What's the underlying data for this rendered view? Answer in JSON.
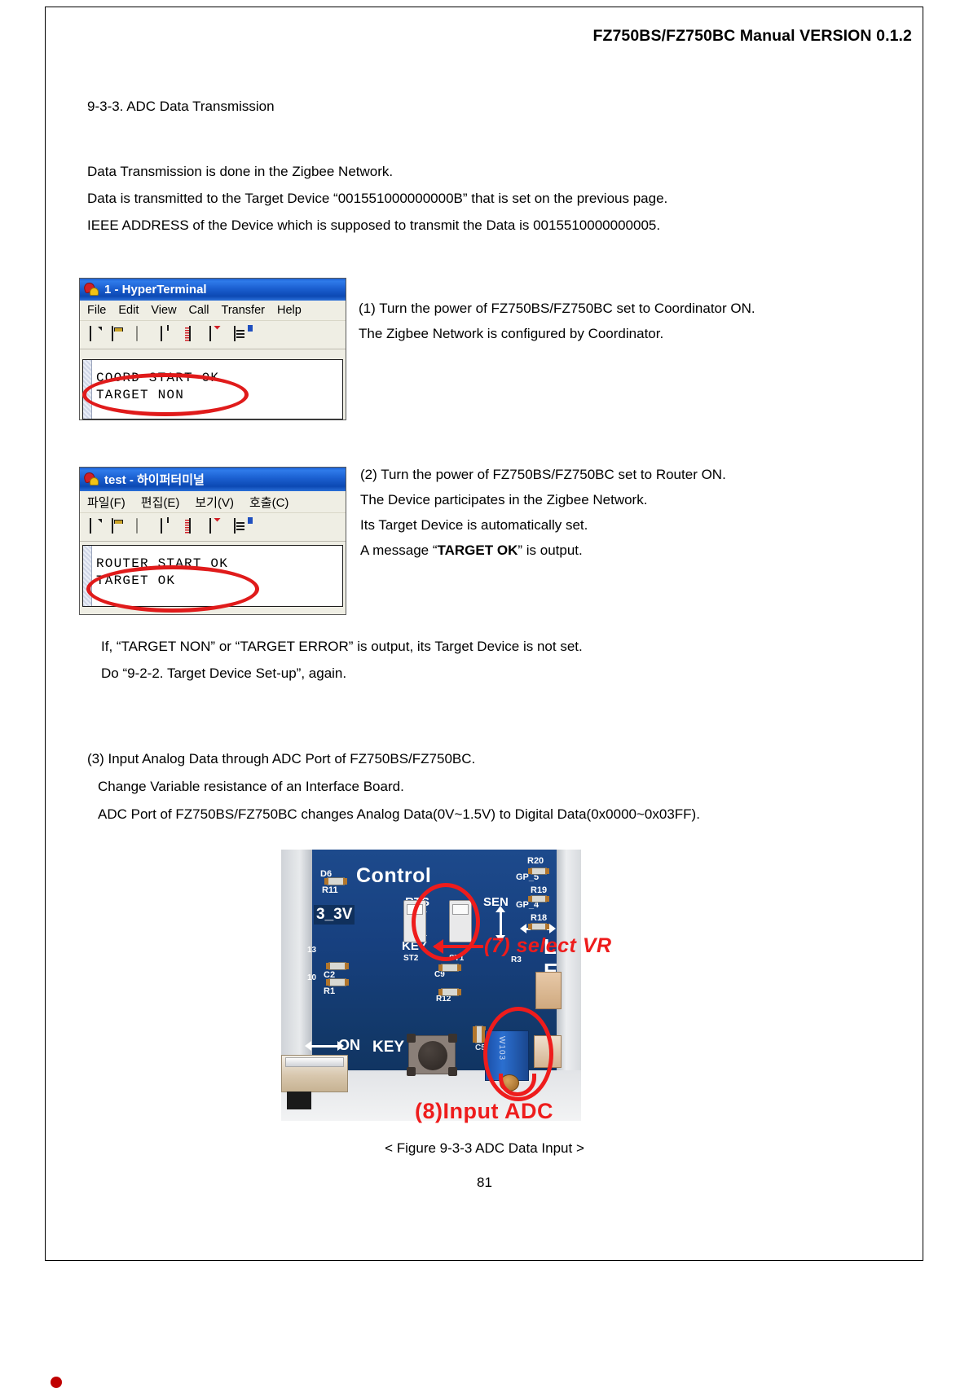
{
  "document": {
    "header_title": "FZ750BS/FZ750BC Manual VERSION 0.1.2",
    "section_heading": "9-3-3. ADC Data Transmission",
    "intro_lines": [
      "Data Transmission is done in the Zigbee Network.",
      "Data is transmitted to the Target Device “001551000000000B” that is set on the previous page.",
      "IEEE ADDRESS of the Device which is supposed to transmit the Data is 0015510000000005."
    ],
    "note_lines": [
      "If, “TARGET NON” or “TARGET ERROR” is output, its Target Device is not set.",
      "Do “9-2-2. Target Device Set-up”, again."
    ],
    "step3_lines": [
      "(3) Input Analog Data through ADC Port of FZ750BS/FZ750BC.",
      "Change Variable resistance of an Interface Board.",
      "ADC Port of FZ750BS/FZ750BC changes Analog Data(0V~1.5V) to Digital Data(0x0000~0x03FF)."
    ],
    "figure_caption": "< Figure 9-3-3 ADC Data Input >",
    "page_number": "81"
  },
  "terminal_one": {
    "title": "1 - HyperTerminal",
    "menu": [
      "File",
      "Edit",
      "View",
      "Call",
      "Transfer",
      "Help"
    ],
    "output": "COORD START OK\nTARGET NON",
    "icon": "hyperterminal-phone-icon"
  },
  "terminal_two": {
    "title": "test - 하이퍼터미널",
    "menu": [
      "파일(F)",
      "편집(E)",
      "보기(V)",
      "호출(C)"
    ],
    "output": "ROUTER START OK\nTARGET OK",
    "icon": "hyperterminal-phone-icon"
  },
  "callout_one": {
    "lines": [
      "(1) Turn the power of FZ750BS/FZ750BC set to Coordinator ON.",
      "The Zigbee Network is configured by Coordinator."
    ]
  },
  "callout_two": {
    "line1": "(2) Turn the power of FZ750BS/FZ750BC set to Router ON.",
    "line2": "The Device participates in the Zigbee Network.",
    "line3": "Its Target Device is automatically set.",
    "line4_pre": "A message “",
    "line4_bold": "TARGET OK",
    "line4_post": "” is output."
  },
  "photo": {
    "silkscreen": {
      "control": "Control",
      "v33": "3_3V",
      "rts": "RTS",
      "sen": "SEN",
      "key_top": "KEY",
      "key_bottom": "KEY",
      "on": "ON",
      "d6": "D6",
      "r11": "R11",
      "c2": "C2",
      "r1": "R1",
      "c9": "C9",
      "r12": "R12",
      "c5": "C5",
      "st2": "ST2",
      "st1": "ST1",
      "r3": "R3",
      "r20": "R20",
      "r19": "R19",
      "r18": "R18",
      "gp5": "GP_5",
      "gp4": "GP_4",
      "led": "L\nE\nD",
      "num13": "13",
      "num10": "10",
      "vr_label": "W103"
    },
    "annotations": {
      "select_vr": "(7) select VR",
      "input_adc": "(8)Input ADC"
    }
  },
  "colors": {
    "annotation_red": "#ee1c1c",
    "titlebar_blue": "#1b5fd0",
    "pcb_blue": "#173b78"
  }
}
